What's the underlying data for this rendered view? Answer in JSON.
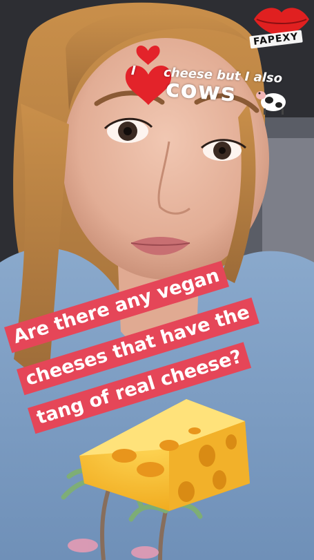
{
  "watermark": "FAPEXY",
  "caption_top": {
    "word_i": "I",
    "word_rest": "cheese but I also",
    "word_cows": "cows"
  },
  "question": {
    "line1": "Are there any vegan",
    "line2": "cheeses that have the",
    "line3": "tang of real cheese?"
  },
  "colors": {
    "banner": "#e54658",
    "heart": "#e3232a",
    "cheese": "#f6c233",
    "shirt": "#7fa4cc"
  }
}
